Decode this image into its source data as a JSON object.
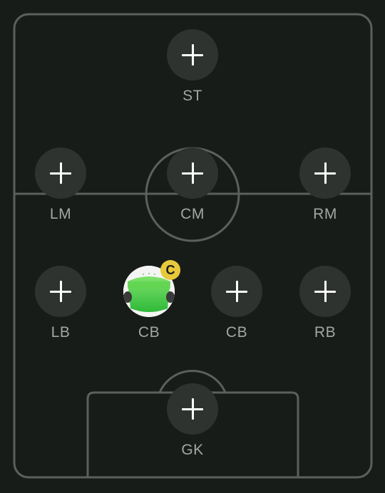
{
  "pitch": {
    "line_color": "#5c605c",
    "background": "#181c18",
    "slot_color": "#2e332f"
  },
  "captain_badge": {
    "text": "C",
    "color": "#e7c93c"
  },
  "positions": {
    "st": {
      "label": "ST",
      "filled": false
    },
    "lm": {
      "label": "LM",
      "filled": false
    },
    "cm": {
      "label": "CM",
      "filled": false
    },
    "rm": {
      "label": "RM",
      "filled": false
    },
    "lb": {
      "label": "LB",
      "filled": false
    },
    "cb_left": {
      "label": "CB",
      "filled": true,
      "captain": true
    },
    "cb_right": {
      "label": "CB",
      "filled": false
    },
    "rb": {
      "label": "RB",
      "filled": false
    },
    "gk": {
      "label": "GK",
      "filled": false
    }
  }
}
